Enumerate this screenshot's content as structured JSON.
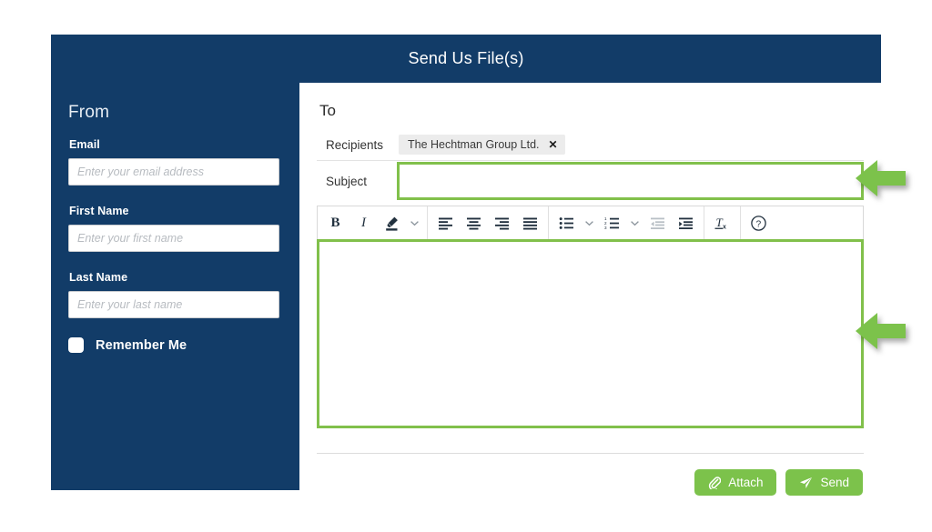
{
  "header": {
    "title": "Send Us File(s)"
  },
  "colors": {
    "navy": "#123C68",
    "green": "#7CC24B",
    "highlight_green": "#81C04B",
    "chip_gray": "#ECECEC"
  },
  "sidebar": {
    "title": "From",
    "fields": [
      {
        "label": "Email",
        "placeholder": "Enter your email address",
        "value": ""
      },
      {
        "label": "First Name",
        "placeholder": "Enter your first name",
        "value": ""
      },
      {
        "label": "Last Name",
        "placeholder": "Enter your last name",
        "value": ""
      }
    ],
    "remember": {
      "label": "Remember Me",
      "checked": false
    }
  },
  "main": {
    "title": "To",
    "recipients": {
      "label": "Recipients",
      "chips": [
        {
          "text": "The Hechtman Group Ltd.",
          "remove": "✕"
        }
      ]
    },
    "subject": {
      "label": "Subject",
      "value": "",
      "placeholder": ""
    },
    "toolbar": {
      "groups": [
        {
          "items": [
            {
              "name": "bold-icon",
              "label": "B"
            },
            {
              "name": "italic-icon",
              "label": "I"
            },
            {
              "name": "highlight-pen-icon",
              "label": ""
            },
            {
              "name": "chevron-down-icon",
              "label": ""
            }
          ]
        },
        {
          "items": [
            {
              "name": "align-left-icon",
              "label": ""
            },
            {
              "name": "align-center-icon",
              "label": ""
            },
            {
              "name": "align-right-icon",
              "label": ""
            },
            {
              "name": "align-justify-icon",
              "label": ""
            }
          ]
        },
        {
          "items": [
            {
              "name": "bulleted-list-icon",
              "label": ""
            },
            {
              "name": "chevron-down-icon",
              "label": ""
            },
            {
              "name": "numbered-list-icon",
              "label": ""
            },
            {
              "name": "chevron-down-icon",
              "label": ""
            },
            {
              "name": "outdent-icon",
              "label": ""
            },
            {
              "name": "indent-icon",
              "label": ""
            }
          ]
        },
        {
          "items": [
            {
              "name": "clear-formatting-icon",
              "label": ""
            }
          ]
        },
        {
          "items": [
            {
              "name": "help-icon",
              "label": ""
            }
          ]
        }
      ]
    },
    "editor": {
      "value": "",
      "placeholder": ""
    },
    "buttons": {
      "attach": "Attach",
      "send": "Send"
    }
  },
  "annotations": [
    {
      "name": "arrow-subject",
      "direction": "left",
      "color": "#7CC24B"
    },
    {
      "name": "arrow-body",
      "direction": "left",
      "color": "#7CC24B"
    }
  ]
}
